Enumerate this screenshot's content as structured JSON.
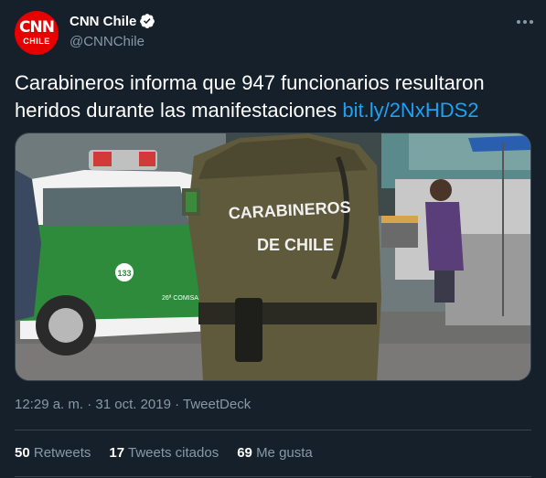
{
  "account": {
    "display_name": "CNN Chile",
    "handle": "@CNNChile",
    "avatar_text_top": "CNN",
    "avatar_text_bottom": "CHILE",
    "verified": true
  },
  "tweet": {
    "text": "Carabineros informa que 947 funcionarios resultaron heridos durante las manifestaciones",
    "link": "bit.ly/2NxHDS2",
    "image": {
      "back_text_line1": "CARABINEROS",
      "back_text_line2": "DE CHILE",
      "car_number": "133",
      "car_text": "26ª COMISARIA"
    },
    "timestamp": "12:29 a. m. · 31 oct. 2019 · TweetDeck"
  },
  "stats": {
    "retweets_count": "50",
    "retweets_label": "Retweets",
    "quotes_count": "17",
    "quotes_label": "Tweets citados",
    "likes_count": "69",
    "likes_label": "Me gusta"
  },
  "colors": {
    "background": "#15202b",
    "link": "#1da1f2",
    "secondary_text": "#8899a6",
    "divider": "#38444d",
    "brand_red": "#e60000"
  }
}
